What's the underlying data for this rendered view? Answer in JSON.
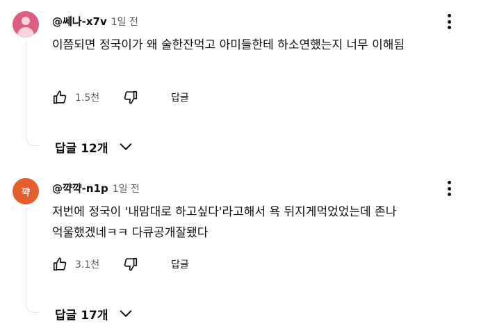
{
  "comments": [
    {
      "handle": "@쎄나-x7v",
      "time": "1일 전",
      "avatar": {
        "type": "default-person",
        "color": "#dd5d82"
      },
      "text": "이쯤되면 정국이가 왜 술한잔먹고 아미들한테 하소연했는지 너무 이해됨",
      "likes": "1.5천",
      "reply_label": "답글",
      "replies_label": "답글 12개"
    },
    {
      "handle": "@꺅꺅-n1p",
      "time": "1일 전",
      "avatar": {
        "type": "initial",
        "initial": "꺅",
        "color": "#e45e2e"
      },
      "text": "저번에 정국이 '내맘대로 하고싶다'라고해서 욕 뒤지게먹었었는데 존나 억울했겠네ㅋㅋ 다큐공개잘됐다",
      "likes": "3.1천",
      "reply_label": "답글",
      "replies_label": "답글 17개"
    }
  ],
  "icons": {
    "like": "thumbs-up-icon",
    "dislike": "thumbs-down-icon",
    "more": "more-vert-icon",
    "expand": "chevron-down-icon"
  },
  "colors": {
    "text": "#0f0f0f",
    "secondary": "#606060",
    "thread_line": "#e5e5e5"
  }
}
